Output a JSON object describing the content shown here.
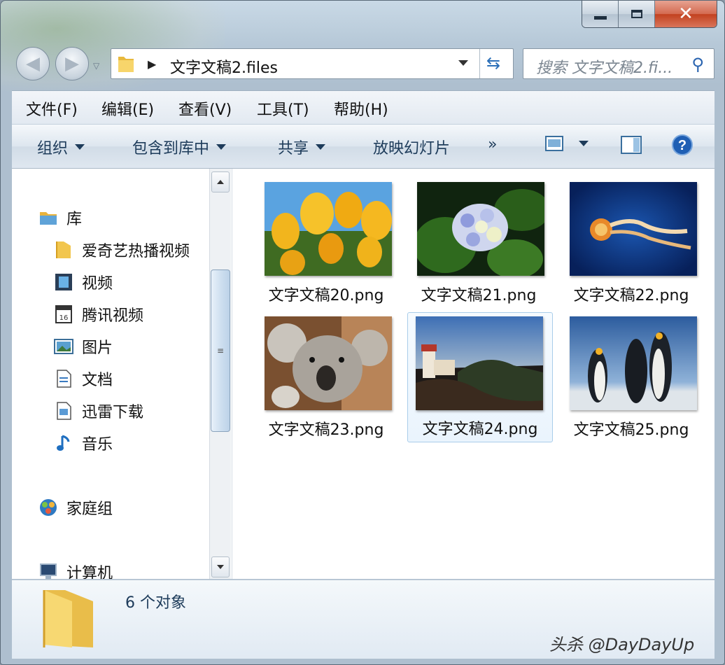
{
  "window": {
    "controls": {
      "minimize": "minimize",
      "maximize": "maximize",
      "close": "✕"
    }
  },
  "address_bar": {
    "path": "文字文稿2.files",
    "separator": "▶",
    "dropdown_icon": "chevron-down-icon",
    "refresh_icon": "refresh-icon"
  },
  "search": {
    "placeholder": "搜索 文字文稿2.fi..."
  },
  "menu": [
    {
      "label": "文件(F)"
    },
    {
      "label": "编辑(E)"
    },
    {
      "label": "查看(V)"
    },
    {
      "label": "工具(T)"
    },
    {
      "label": "帮助(H)"
    }
  ],
  "toolbar": {
    "organize": "组织",
    "include_in_library": "包含到库中",
    "share": "共享",
    "slideshow": "放映幻灯片",
    "more": "»",
    "help": "?"
  },
  "nav_pane": {
    "libraries": "库",
    "library_items": [
      {
        "label": "爱奇艺热播视频",
        "icon": "folder-icon"
      },
      {
        "label": "视频",
        "icon": "video-library-icon"
      },
      {
        "label": "腾讯视频",
        "icon": "tencent-video-icon"
      },
      {
        "label": "图片",
        "icon": "pictures-library-icon"
      },
      {
        "label": "文档",
        "icon": "documents-library-icon"
      },
      {
        "label": "迅雷下载",
        "icon": "thunder-download-icon"
      },
      {
        "label": "音乐",
        "icon": "music-library-icon"
      }
    ],
    "homegroup": "家庭组",
    "computer": "计算机",
    "scroll_grip": "≡"
  },
  "files": [
    {
      "name": "文字文稿20.png",
      "thumbnail": "tulips-photo",
      "selected": false
    },
    {
      "name": "文字文稿21.png",
      "thumbnail": "hydrangea-photo",
      "selected": false
    },
    {
      "name": "文字文稿22.png",
      "thumbnail": "jellyfish-photo",
      "selected": false
    },
    {
      "name": "文字文稿23.png",
      "thumbnail": "koala-photo",
      "selected": false
    },
    {
      "name": "文字文稿24.png",
      "thumbnail": "lighthouse-photo",
      "selected": true
    },
    {
      "name": "文字文稿25.png",
      "thumbnail": "penguins-photo",
      "selected": false
    }
  ],
  "status_bar": {
    "count": "6 个对象"
  },
  "watermark": "头杀 @DayDayUp",
  "colors": {
    "accent": "#2b6fb8",
    "selection_border": "#a9cdea",
    "close_button": "#c2411f"
  }
}
